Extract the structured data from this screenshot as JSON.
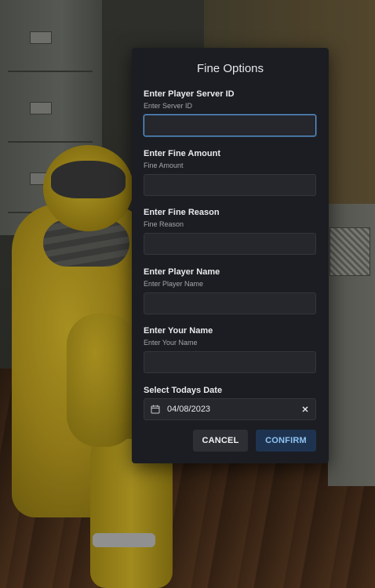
{
  "dialog": {
    "title": "Fine Options",
    "fields": [
      {
        "label": "Enter Player Server ID",
        "hint": "Enter Server ID",
        "value": ""
      },
      {
        "label": "Enter Fine Amount",
        "hint": "Fine Amount",
        "value": ""
      },
      {
        "label": "Enter Fine Reason",
        "hint": "Fine Reason",
        "value": ""
      },
      {
        "label": "Enter Player Name",
        "hint": "Enter Player Name",
        "value": ""
      },
      {
        "label": "Enter Your Name",
        "hint": "Enter Your Name",
        "value": ""
      }
    ],
    "date": {
      "label": "Select Todays Date",
      "value": "04/08/2023",
      "icon": "calendar-icon",
      "clear_icon": "close-icon"
    },
    "buttons": {
      "cancel": "CANCEL",
      "confirm": "CONFIRM"
    }
  },
  "colors": {
    "dialog_bg": "#1b1d22",
    "input_bg": "#25272d",
    "focus_border": "#5c9cde",
    "confirm_bg": "#1e3350",
    "confirm_text": "#8ec3f2"
  }
}
